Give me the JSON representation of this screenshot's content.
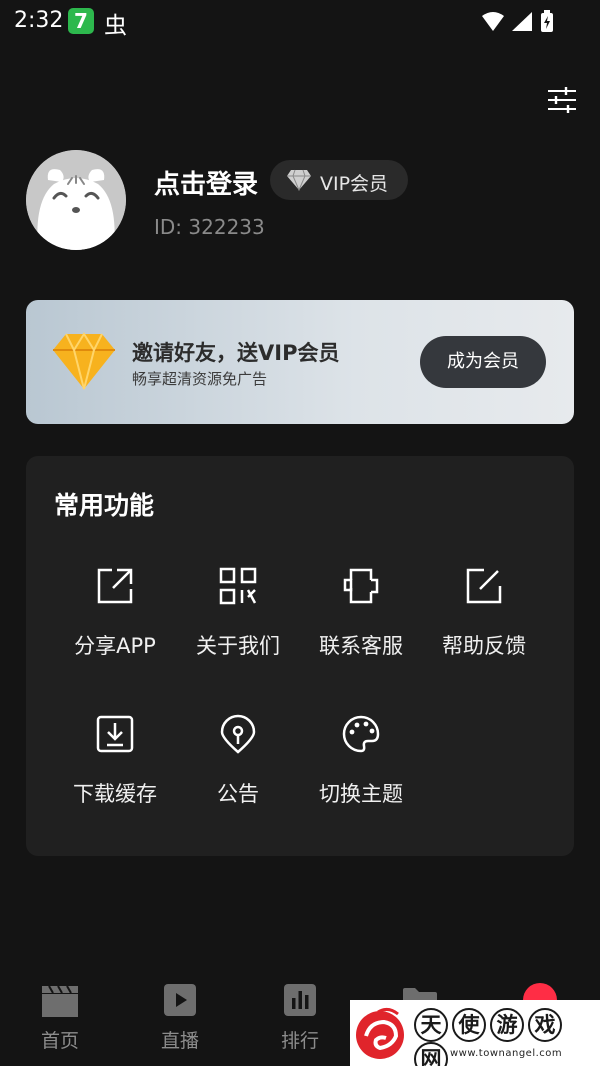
{
  "status_bar": {
    "time": "2:32",
    "app_badge_text": "7",
    "bug_glyph": "虫",
    "icons": [
      "wifi-icon",
      "signal-icon",
      "battery-charging-icon"
    ]
  },
  "header": {
    "settings_icon": "sliders-icon"
  },
  "profile": {
    "login_text": "点击登录",
    "vip_label": "VIP会员",
    "user_id": "ID: 322233",
    "avatar_icon": "panda-avatar-icon"
  },
  "banner": {
    "title": "邀请好友，送VIP会员",
    "subtitle": "畅享超清资源免广告",
    "button_label": "成为会员",
    "icon": "diamond-icon"
  },
  "functions": {
    "title": "常用功能",
    "items": [
      {
        "label": "分享APP",
        "icon": "share-icon"
      },
      {
        "label": "关于我们",
        "icon": "qr-grid-icon"
      },
      {
        "label": "联系客服",
        "icon": "phone-icon"
      },
      {
        "label": "帮助反馈",
        "icon": "edit-icon"
      },
      {
        "label": "下载缓存",
        "icon": "download-icon"
      },
      {
        "label": "公告",
        "icon": "notice-icon"
      },
      {
        "label": "切换主题",
        "icon": "palette-icon"
      }
    ]
  },
  "bottom_nav": {
    "items": [
      {
        "label": "首页",
        "icon": "clapper-icon"
      },
      {
        "label": "直播",
        "icon": "play-icon"
      },
      {
        "label": "排行",
        "icon": "chart-icon"
      }
    ]
  },
  "watermark": {
    "chars": [
      "天",
      "使",
      "游",
      "戏",
      "网"
    ],
    "url": "www.townangel.com"
  },
  "colors": {
    "background": "#141414",
    "card": "#202020",
    "muted_text": "#8a8a8a",
    "banner_button": "#35383d",
    "diamond": "#f5a91c"
  }
}
